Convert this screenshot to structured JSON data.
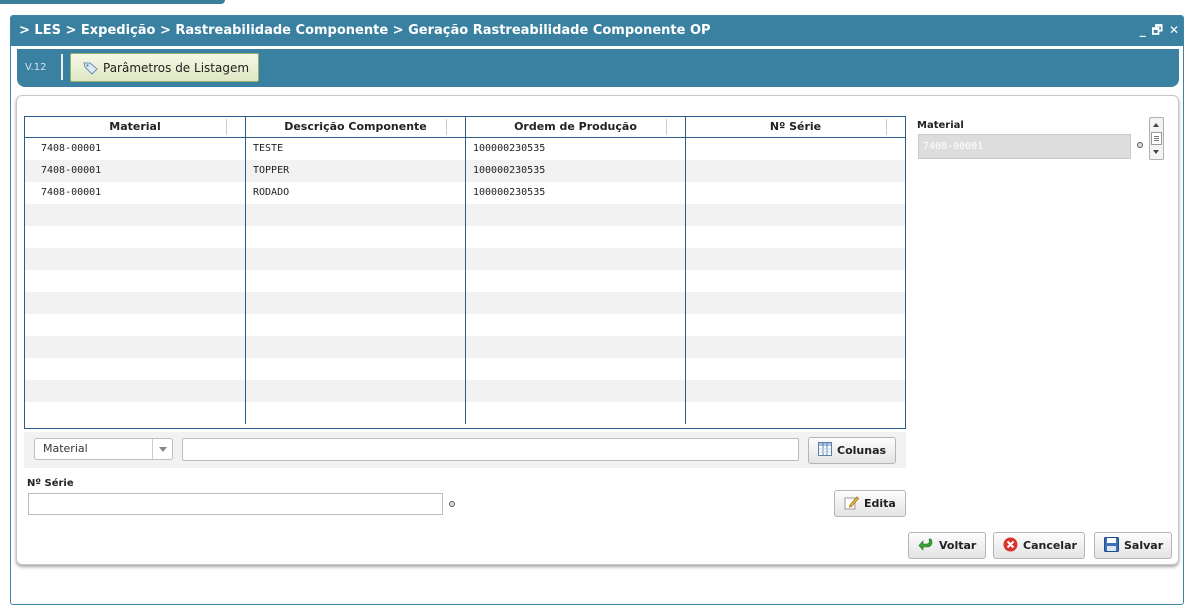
{
  "window": {
    "title": "> LES > Expedição > Rastreabilidade Componente > Geração Rastreabilidade Componente OP",
    "minimize": "_",
    "restore": "🗗",
    "close": "✕"
  },
  "toolbar": {
    "version": "V.12",
    "params_button": "Parâmetros de Listagem"
  },
  "grid": {
    "columns": [
      "Material",
      "Descrição Componente",
      "Ordem de Produção",
      "Nº Série"
    ],
    "rows": [
      [
        "7408-00001",
        "TESTE",
        "100000230535",
        ""
      ],
      [
        "7408-00001",
        "TOPPER",
        "100000230535",
        ""
      ],
      [
        "7408-00001",
        "RODADO",
        "100000230535",
        ""
      ],
      [
        "",
        "",
        "",
        ""
      ],
      [
        "",
        "",
        "",
        ""
      ],
      [
        "",
        "",
        "",
        ""
      ],
      [
        "",
        "",
        "",
        ""
      ],
      [
        "",
        "",
        "",
        ""
      ],
      [
        "",
        "",
        "",
        ""
      ],
      [
        "",
        "",
        "",
        ""
      ],
      [
        "",
        "",
        "",
        ""
      ],
      [
        "",
        "",
        "",
        ""
      ],
      [
        "",
        "",
        "",
        ""
      ]
    ]
  },
  "filter": {
    "combo_value": "Material",
    "input_value": "",
    "columns_button": "Colunas"
  },
  "serie": {
    "label": "Nº Série",
    "value": "",
    "edit_button": "Edita"
  },
  "side": {
    "label": "Material",
    "value": "7408-00001"
  },
  "actions": {
    "back": "Voltar",
    "cancel": "Cancelar",
    "save": "Salvar"
  },
  "colors": {
    "titlebar": "#3a80a1",
    "grid_border": "#2d5b8a"
  },
  "icons": {
    "params": "tag-icon",
    "columns": "columns-icon",
    "edit": "pencil-icon",
    "back": "back-arrow-icon",
    "cancel": "cancel-icon",
    "save": "floppy-disk-icon"
  }
}
